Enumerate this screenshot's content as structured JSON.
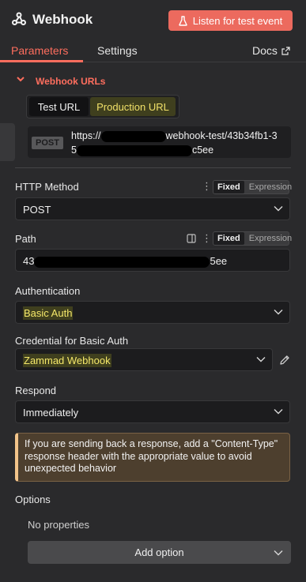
{
  "header": {
    "title": "Webhook",
    "listen_button": "Listen for test event"
  },
  "tabs": [
    {
      "label": "Parameters",
      "active": true
    },
    {
      "label": "Settings",
      "active": false
    },
    {
      "label": "Docs",
      "active": false
    }
  ],
  "webhook_urls": {
    "section_title": "Webhook URLs",
    "toggle": {
      "test": "Test URL",
      "production": "Production URL",
      "selected": "Test URL"
    },
    "method_badge": "POST",
    "url_line1_start": "https://",
    "url_line1_end": "webhook-test/43b34fb1-3",
    "url_line2_start": "5",
    "url_line2_end": "c5ee"
  },
  "fields": {
    "http_method": {
      "label": "HTTP Method",
      "value": "POST",
      "mode_fixed": "Fixed",
      "mode_expr": "Expression"
    },
    "path": {
      "label": "Path",
      "value_start": "43",
      "value_end": "5ee",
      "mode_fixed": "Fixed",
      "mode_expr": "Expression"
    },
    "authentication": {
      "label": "Authentication",
      "value": "Basic Auth"
    },
    "credential": {
      "label": "Credential for Basic Auth",
      "value": "Zammad Webhook"
    },
    "respond": {
      "label": "Respond",
      "value": "Immediately"
    }
  },
  "notice": "If you are sending back a response, add a \"Content-Type\" response header with the appropriate value to avoid unexpected behavior",
  "options": {
    "label": "Options",
    "empty_text": "No properties",
    "add_button": "Add option"
  },
  "colors": {
    "accent": "#ff6e5e",
    "listen_button_bg": "#ec6a5e",
    "highlight_text": "#f5e86a",
    "notice_bg": "#4d3f2e"
  },
  "icons": {
    "node": "webhook-icon",
    "listen": "flask-icon",
    "docs": "external-link-icon",
    "section": "chevron-down-icon",
    "credential_edit": "pencil-icon"
  }
}
